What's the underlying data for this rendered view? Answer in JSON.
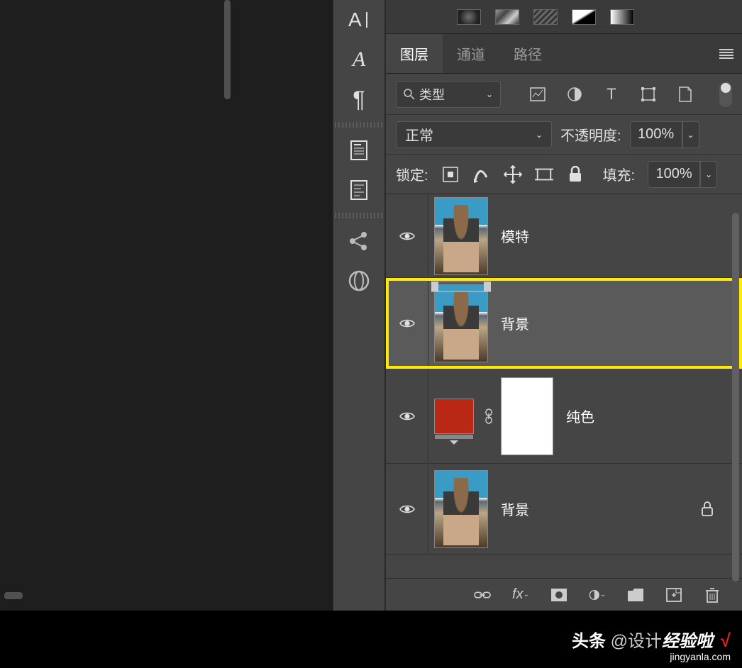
{
  "tabs": {
    "layers": "图层",
    "channels": "通道",
    "paths": "路径"
  },
  "filter": {
    "label": "类型"
  },
  "blend": {
    "mode": "正常",
    "opacity_label": "不透明度:",
    "opacity_value": "100%"
  },
  "lock": {
    "label": "锁定:",
    "fill_label": "填充:",
    "fill_value": "100%"
  },
  "layers": [
    {
      "name": "模特",
      "selected": false,
      "highlighted": false,
      "type": "image",
      "locked": false
    },
    {
      "name": "背景",
      "selected": true,
      "highlighted": true,
      "type": "smart",
      "locked": false
    },
    {
      "name": "纯色",
      "selected": false,
      "highlighted": false,
      "type": "solidcolor",
      "locked": false
    },
    {
      "name": "背景",
      "selected": false,
      "highlighted": false,
      "type": "image",
      "locked": true
    }
  ],
  "footer": {
    "brand": "头条",
    "account": "@设计",
    "suffix": "经验啦",
    "url": "jingyanla.com"
  }
}
